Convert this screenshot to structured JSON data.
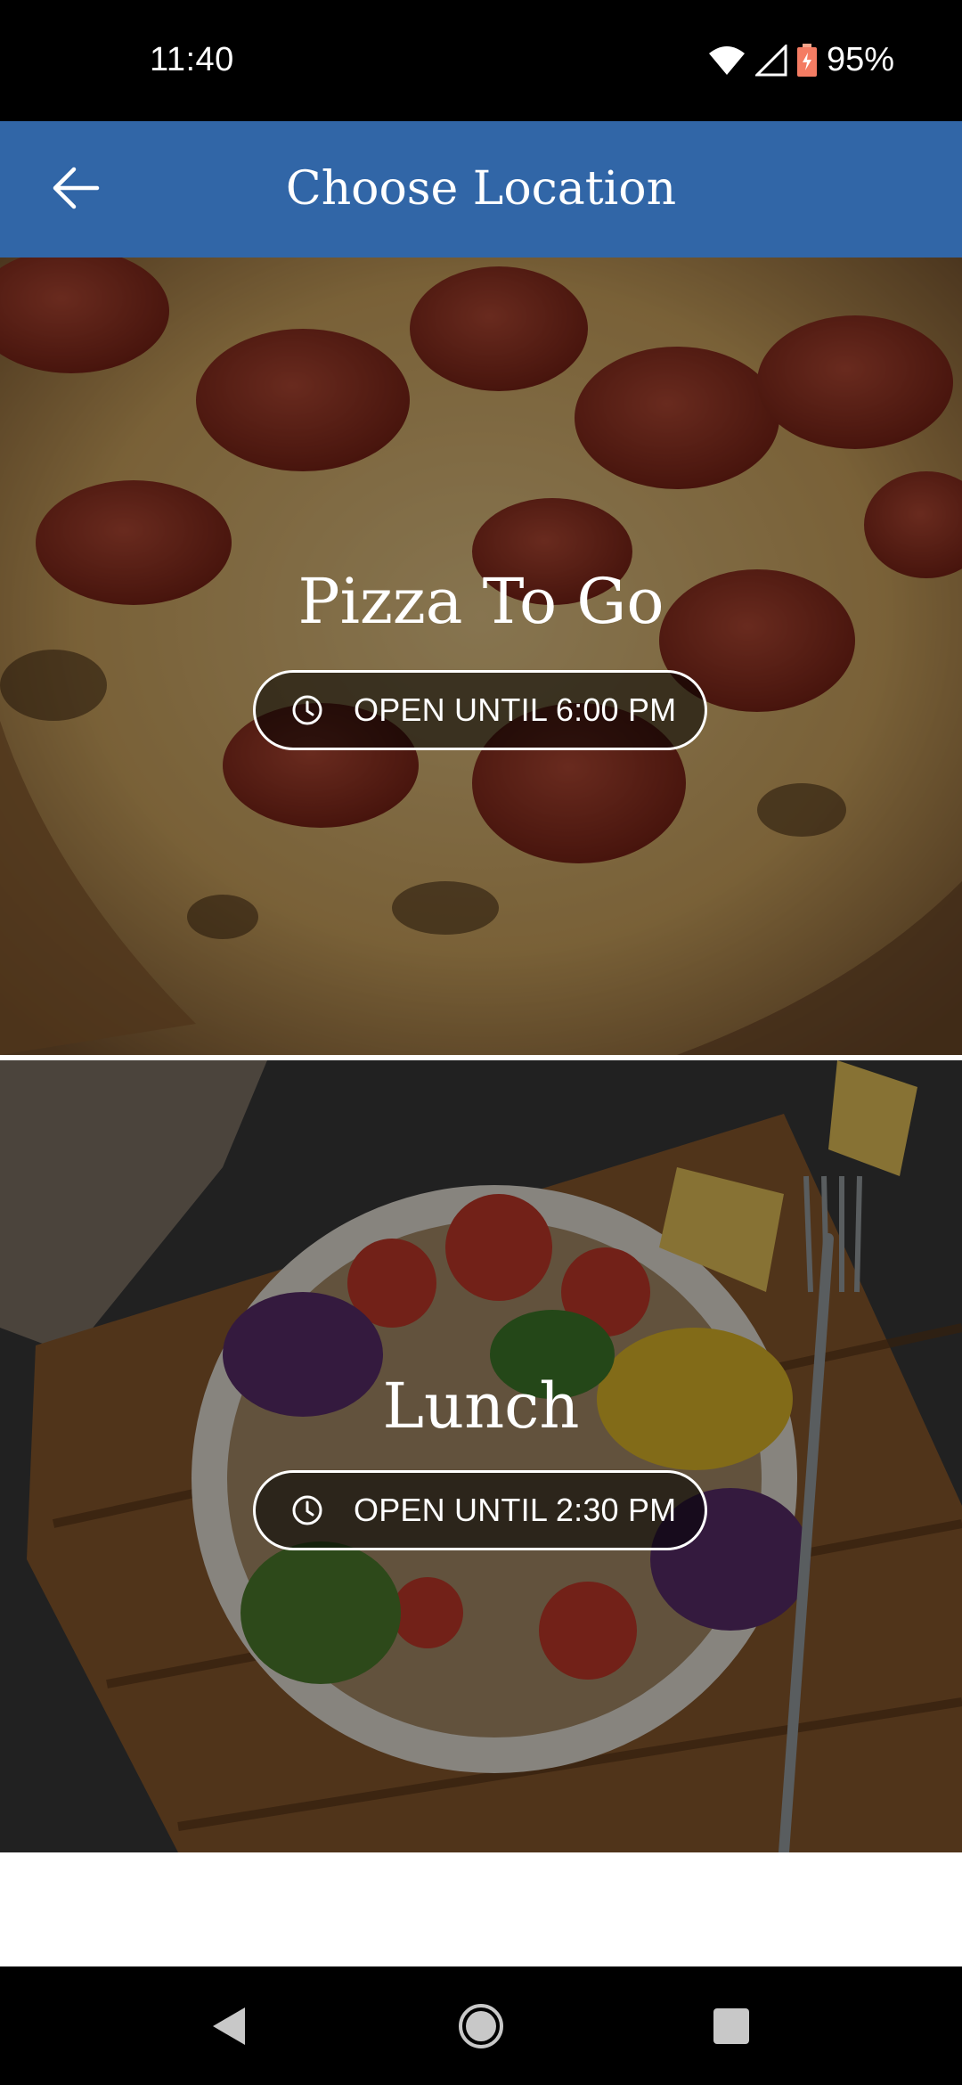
{
  "status_bar": {
    "time": "11:40",
    "battery_percent": "95%",
    "icons": [
      "wifi-icon",
      "cell-signal-icon",
      "battery-icon"
    ]
  },
  "app_bar": {
    "title": "Choose Location",
    "back_icon": "arrow-left-icon",
    "color": "#3166a7"
  },
  "locations": [
    {
      "name": "Pizza To Go",
      "hours": "OPEN UNTIL 6:00 PM",
      "hours_icon": "clock-icon",
      "image": "pepperoni-pizza-photo"
    },
    {
      "name": "Lunch",
      "hours": "OPEN UNTIL 2:30 PM",
      "hours_icon": "clock-icon",
      "image": "salad-bowl-photo"
    }
  ],
  "nav_bar": {
    "buttons": [
      "back-triangle-icon",
      "home-circle-icon",
      "recents-square-icon"
    ]
  }
}
